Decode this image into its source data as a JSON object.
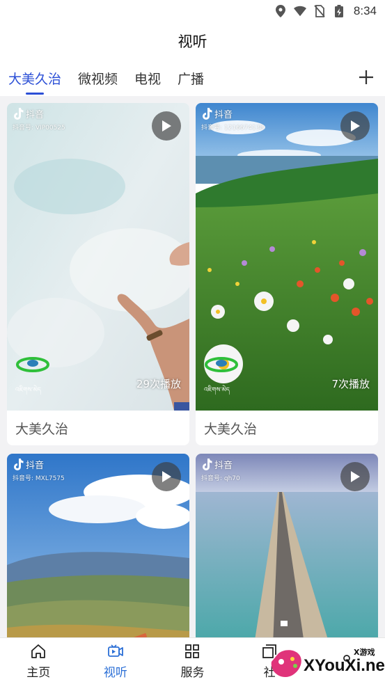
{
  "status": {
    "time": "8:34"
  },
  "header": {
    "title": "视听"
  },
  "tabs": [
    {
      "label": "大美久治",
      "active": true
    },
    {
      "label": "微视频",
      "active": false
    },
    {
      "label": "电视",
      "active": false
    },
    {
      "label": "广播",
      "active": false
    }
  ],
  "cards": [
    {
      "platform": "抖音",
      "account": "抖音号: VIP00525",
      "plays": "29次播放",
      "title": "大美久治",
      "watermark": "འཇིགས་མེད"
    },
    {
      "platform": "抖音",
      "account": "抖音号: 1216674138",
      "plays": "7次播放",
      "title": "大美久治",
      "watermark": "འཇིགས་མེད"
    },
    {
      "platform": "抖音",
      "account": "抖音号: MXL7575"
    },
    {
      "platform": "抖音",
      "account": "抖音号: qh70"
    }
  ],
  "bottom_nav": [
    {
      "label": "主页",
      "icon": "home-icon",
      "active": false
    },
    {
      "label": "视听",
      "icon": "video-icon",
      "active": true
    },
    {
      "label": "服务",
      "icon": "grid-icon",
      "active": false
    },
    {
      "label": "社",
      "icon": "community-icon",
      "active": false
    }
  ],
  "ad": {
    "brand": "XYouXi.net",
    "tag": "X游戏"
  },
  "colors": {
    "accent": "#2b4fd6",
    "nav_active": "#2b6fd6"
  }
}
